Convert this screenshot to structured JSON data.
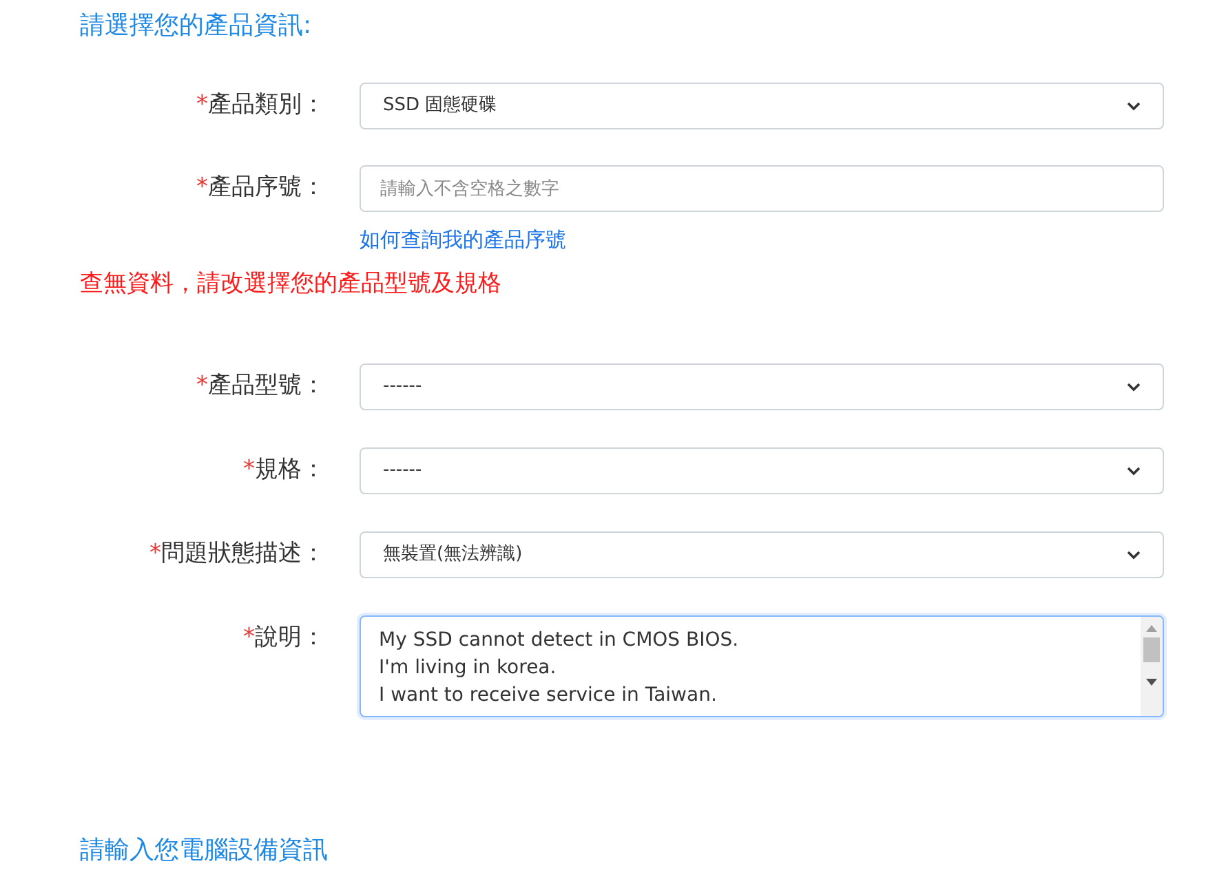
{
  "section_title": "請選擇您的產品資訊:",
  "fields_top": [
    {
      "kind": "select",
      "marker": "*",
      "label": "產品類別：",
      "value": "SSD 固態硬碟"
    },
    {
      "kind": "input",
      "marker": "*",
      "label": "產品序號：",
      "placeholder": "請輸入不含空格之數字",
      "link": "如何查詢我的產品序號"
    }
  ],
  "error_message": "查無資料，請改選擇您的產品型號及規格",
  "fields_bottom": [
    {
      "kind": "select",
      "marker": "*",
      "label": "產品型號：",
      "value": "------"
    },
    {
      "kind": "select",
      "marker": "*",
      "label": "規格：",
      "value": "------"
    },
    {
      "kind": "select",
      "marker": "*",
      "label": "問題狀態描述：",
      "value": "無裝置(無法辨識)"
    },
    {
      "kind": "textarea",
      "marker": "*",
      "label": "說明：",
      "lines": [
        "My SSD cannot detect in CMOS BIOS.",
        "I'm living in korea.",
        "I want to receive service in Taiwan."
      ]
    }
  ],
  "next_section_title": "請輸入您電腦設備資訊"
}
